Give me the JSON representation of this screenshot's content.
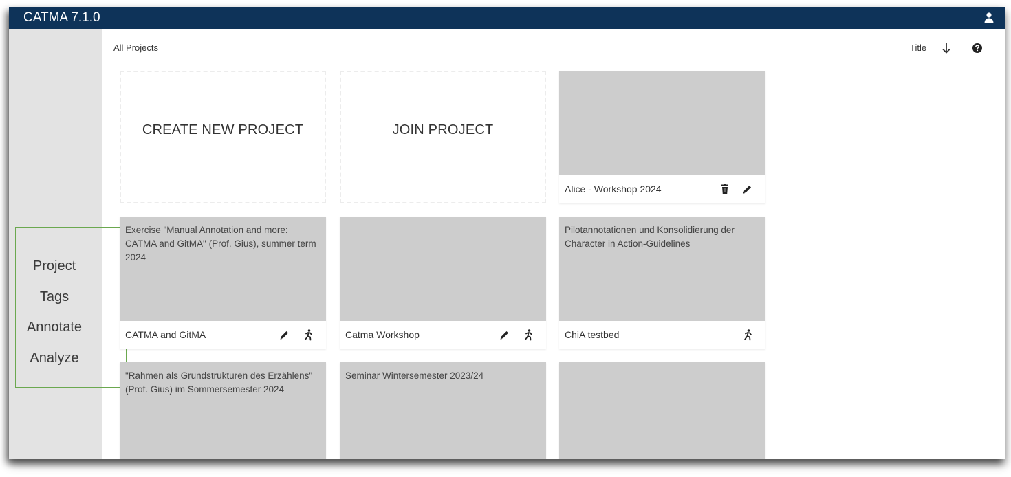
{
  "app": {
    "title": "CATMA 7.1.0"
  },
  "sidebar": {
    "items": [
      {
        "label": "Project"
      },
      {
        "label": "Tags"
      },
      {
        "label": "Annotate"
      },
      {
        "label": "Analyze"
      }
    ]
  },
  "main": {
    "header": "All Projects",
    "sort_label": "Title",
    "actions": {
      "create_label": "CREATE NEW PROJECT",
      "join_label": "JOIN PROJECT"
    },
    "projects": [
      {
        "description": "",
        "name": "Alice - Workshop 2024"
      },
      {
        "description": "Exercise \"Manual Annotation and more: CATMA and GitMA\" (Prof. Gius), summer term 2024",
        "name": "CATMA and GitMA"
      },
      {
        "description": "",
        "name": "Catma Workshop"
      },
      {
        "description": "Pilotannotationen und Konsolidierung der Character in Action-Guidelines",
        "name": "ChiA testbed"
      },
      {
        "description": "\"Rahmen als Grundstrukturen des Erzählens\" (Prof. Gius) im Sommersemester 2024",
        "name": ""
      },
      {
        "description": "Seminar Wintersemester 2023/24",
        "name": ""
      },
      {
        "description": "",
        "name": ""
      }
    ]
  },
  "icons": {
    "user": "user-icon",
    "sort": "arrow-down-icon",
    "help": "help-icon",
    "delete": "trash-icon",
    "edit": "pencil-icon",
    "leave": "running-person-icon"
  },
  "colors": {
    "topbar": "#0e3359",
    "sidebar": "#e3e3e3",
    "card_description": "#cdcdcd",
    "nav_highlight_border": "#6ba84f"
  }
}
